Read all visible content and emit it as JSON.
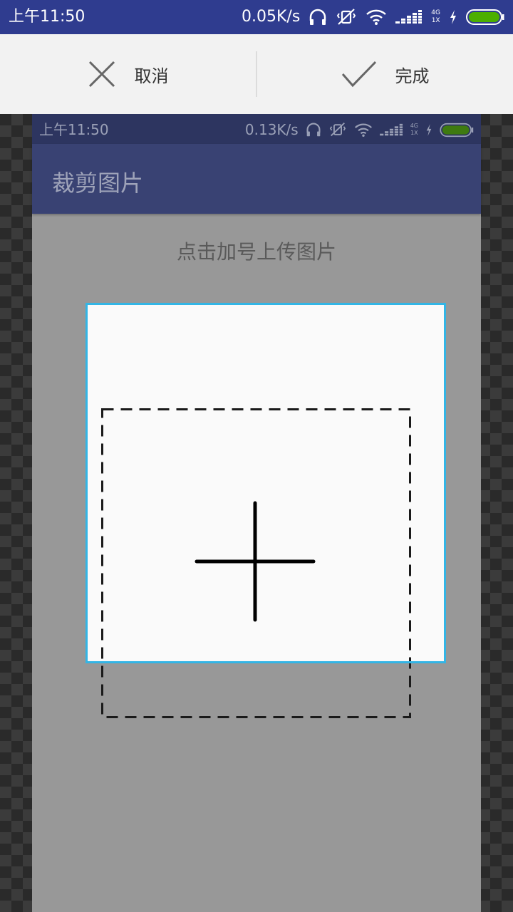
{
  "status_bar": {
    "time": "上午11:50",
    "speed": "0.05K/s",
    "network": "4G",
    "sim": "1X",
    "icons": [
      "headphones-icon",
      "vibrate-off-icon",
      "wifi-icon",
      "signal-icon",
      "charging-icon",
      "battery-icon"
    ],
    "color": "#2f3c8f"
  },
  "toolbar": {
    "cancel_label": "取消",
    "done_label": "完成"
  },
  "preview": {
    "status_time": "上午11:50",
    "status_speed": "0.13K/s",
    "network": "4G",
    "sim": "1X",
    "title": "裁剪图片",
    "hint": "点击加号上传图片",
    "appbar_color": "#394273"
  },
  "crop_frame": {
    "border_color": "#33b5e5"
  }
}
